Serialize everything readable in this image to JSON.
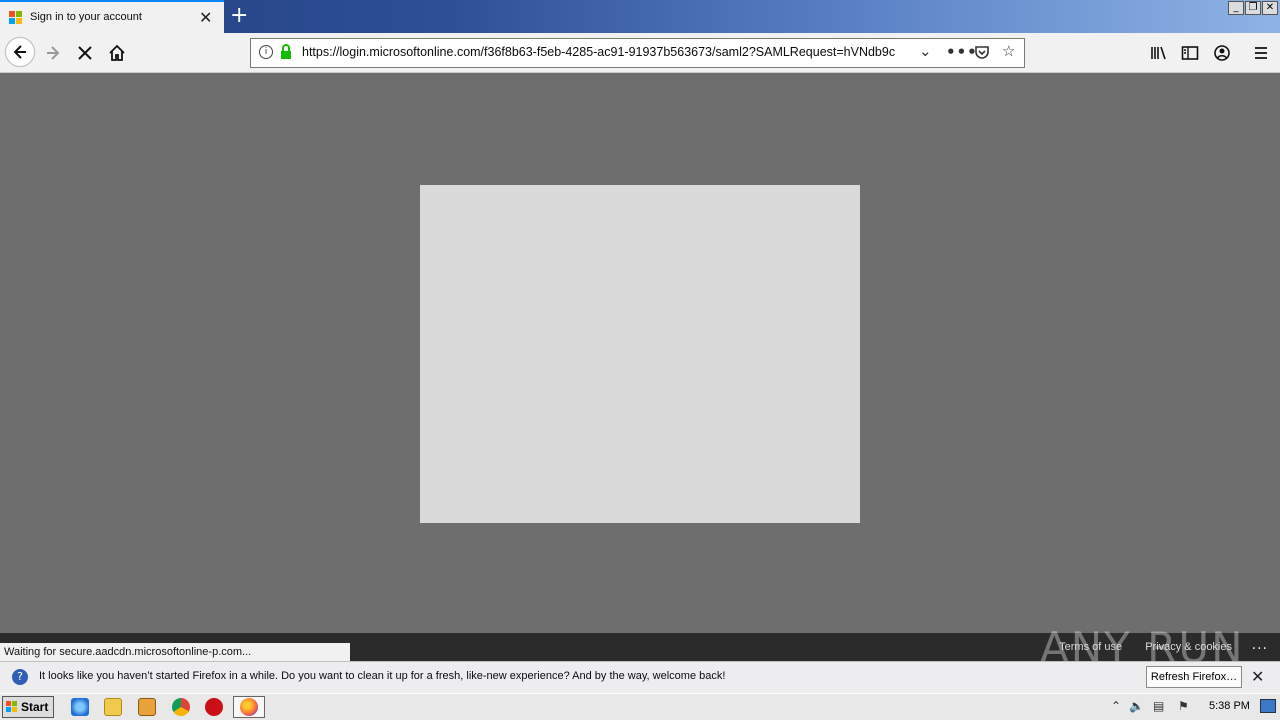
{
  "browser": {
    "tab": {
      "title": "Sign in to your account",
      "close_glyph": "✕"
    },
    "new_tab_glyph": "+",
    "window_buttons": {
      "minimize": "_",
      "restore": "❐",
      "close": "✕"
    },
    "url": "https://login.microsoftonline.com/f36f8b63-f5eb-4285-ac91-91937b563673/saml2?SAMLRequest=hVNdb9c",
    "icons": {
      "back": "back-arrow-icon",
      "forward": "forward-arrow-icon",
      "stop": "stop-icon",
      "home": "home-icon",
      "info": "info-icon",
      "lock": "lock-icon",
      "url_dropdown": "chevron-down-icon",
      "page_actions": "more-horiz-icon",
      "pocket": "pocket-icon",
      "bookmark": "star-icon",
      "library": "library-icon",
      "sidebar": "sidebar-icon",
      "account": "account-icon",
      "menu": "hamburger-icon"
    }
  },
  "page": {
    "status_text": "Waiting for secure.aadcdn.microsoftonline-p.com...",
    "footer_links": [
      "Terms of use",
      "Privacy & cookies"
    ],
    "footer_more": "...",
    "watermark": "ANY RUN"
  },
  "notification": {
    "message": "It looks like you haven’t started Firefox in a while. Do you want to clean it up for a fresh, like-new experience? And by the way, welcome back!",
    "button_label": "Refresh Firefox…",
    "close_glyph": "✕"
  },
  "taskbar": {
    "start_label": "Start",
    "clock": "5:38 PM"
  },
  "colors": {
    "tab_accent": "#0a84ff",
    "lock_green": "#12bc00",
    "content_bg": "#6e6e6e",
    "login_placeholder": "#dadada"
  }
}
